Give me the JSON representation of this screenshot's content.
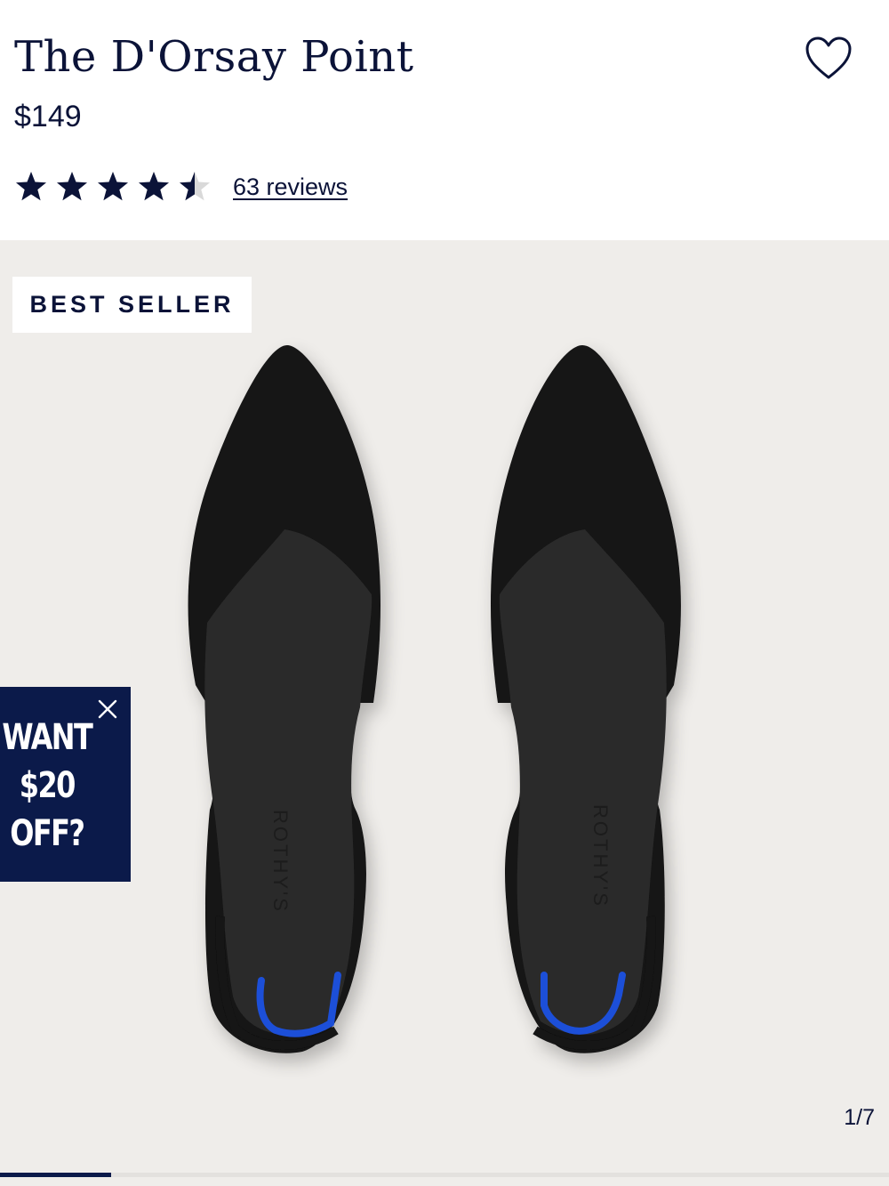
{
  "product": {
    "title": "The D'Orsay Point",
    "price": "$149",
    "rating": 4.5,
    "rating_max": 5,
    "reviews_label": "63 reviews"
  },
  "gallery": {
    "badge": "BEST SELLER",
    "counter": "1/7",
    "current_index": 1,
    "total_images": 7,
    "insole_brand": "ROTHY'S",
    "image_description": "Pair of black pointed-toe d'Orsay flats"
  },
  "promo": {
    "text_line1": "WANT",
    "text_line2": "$20",
    "text_line3": "OFF?"
  },
  "colors": {
    "navy": "#0b1338",
    "promo_bg": "#0b1a4a",
    "gallery_bg": "#efedea",
    "heel_accent": "#1f4fd8"
  },
  "icons": {
    "wishlist": "heart-outline-icon",
    "close": "close-icon",
    "star": "star-icon"
  }
}
